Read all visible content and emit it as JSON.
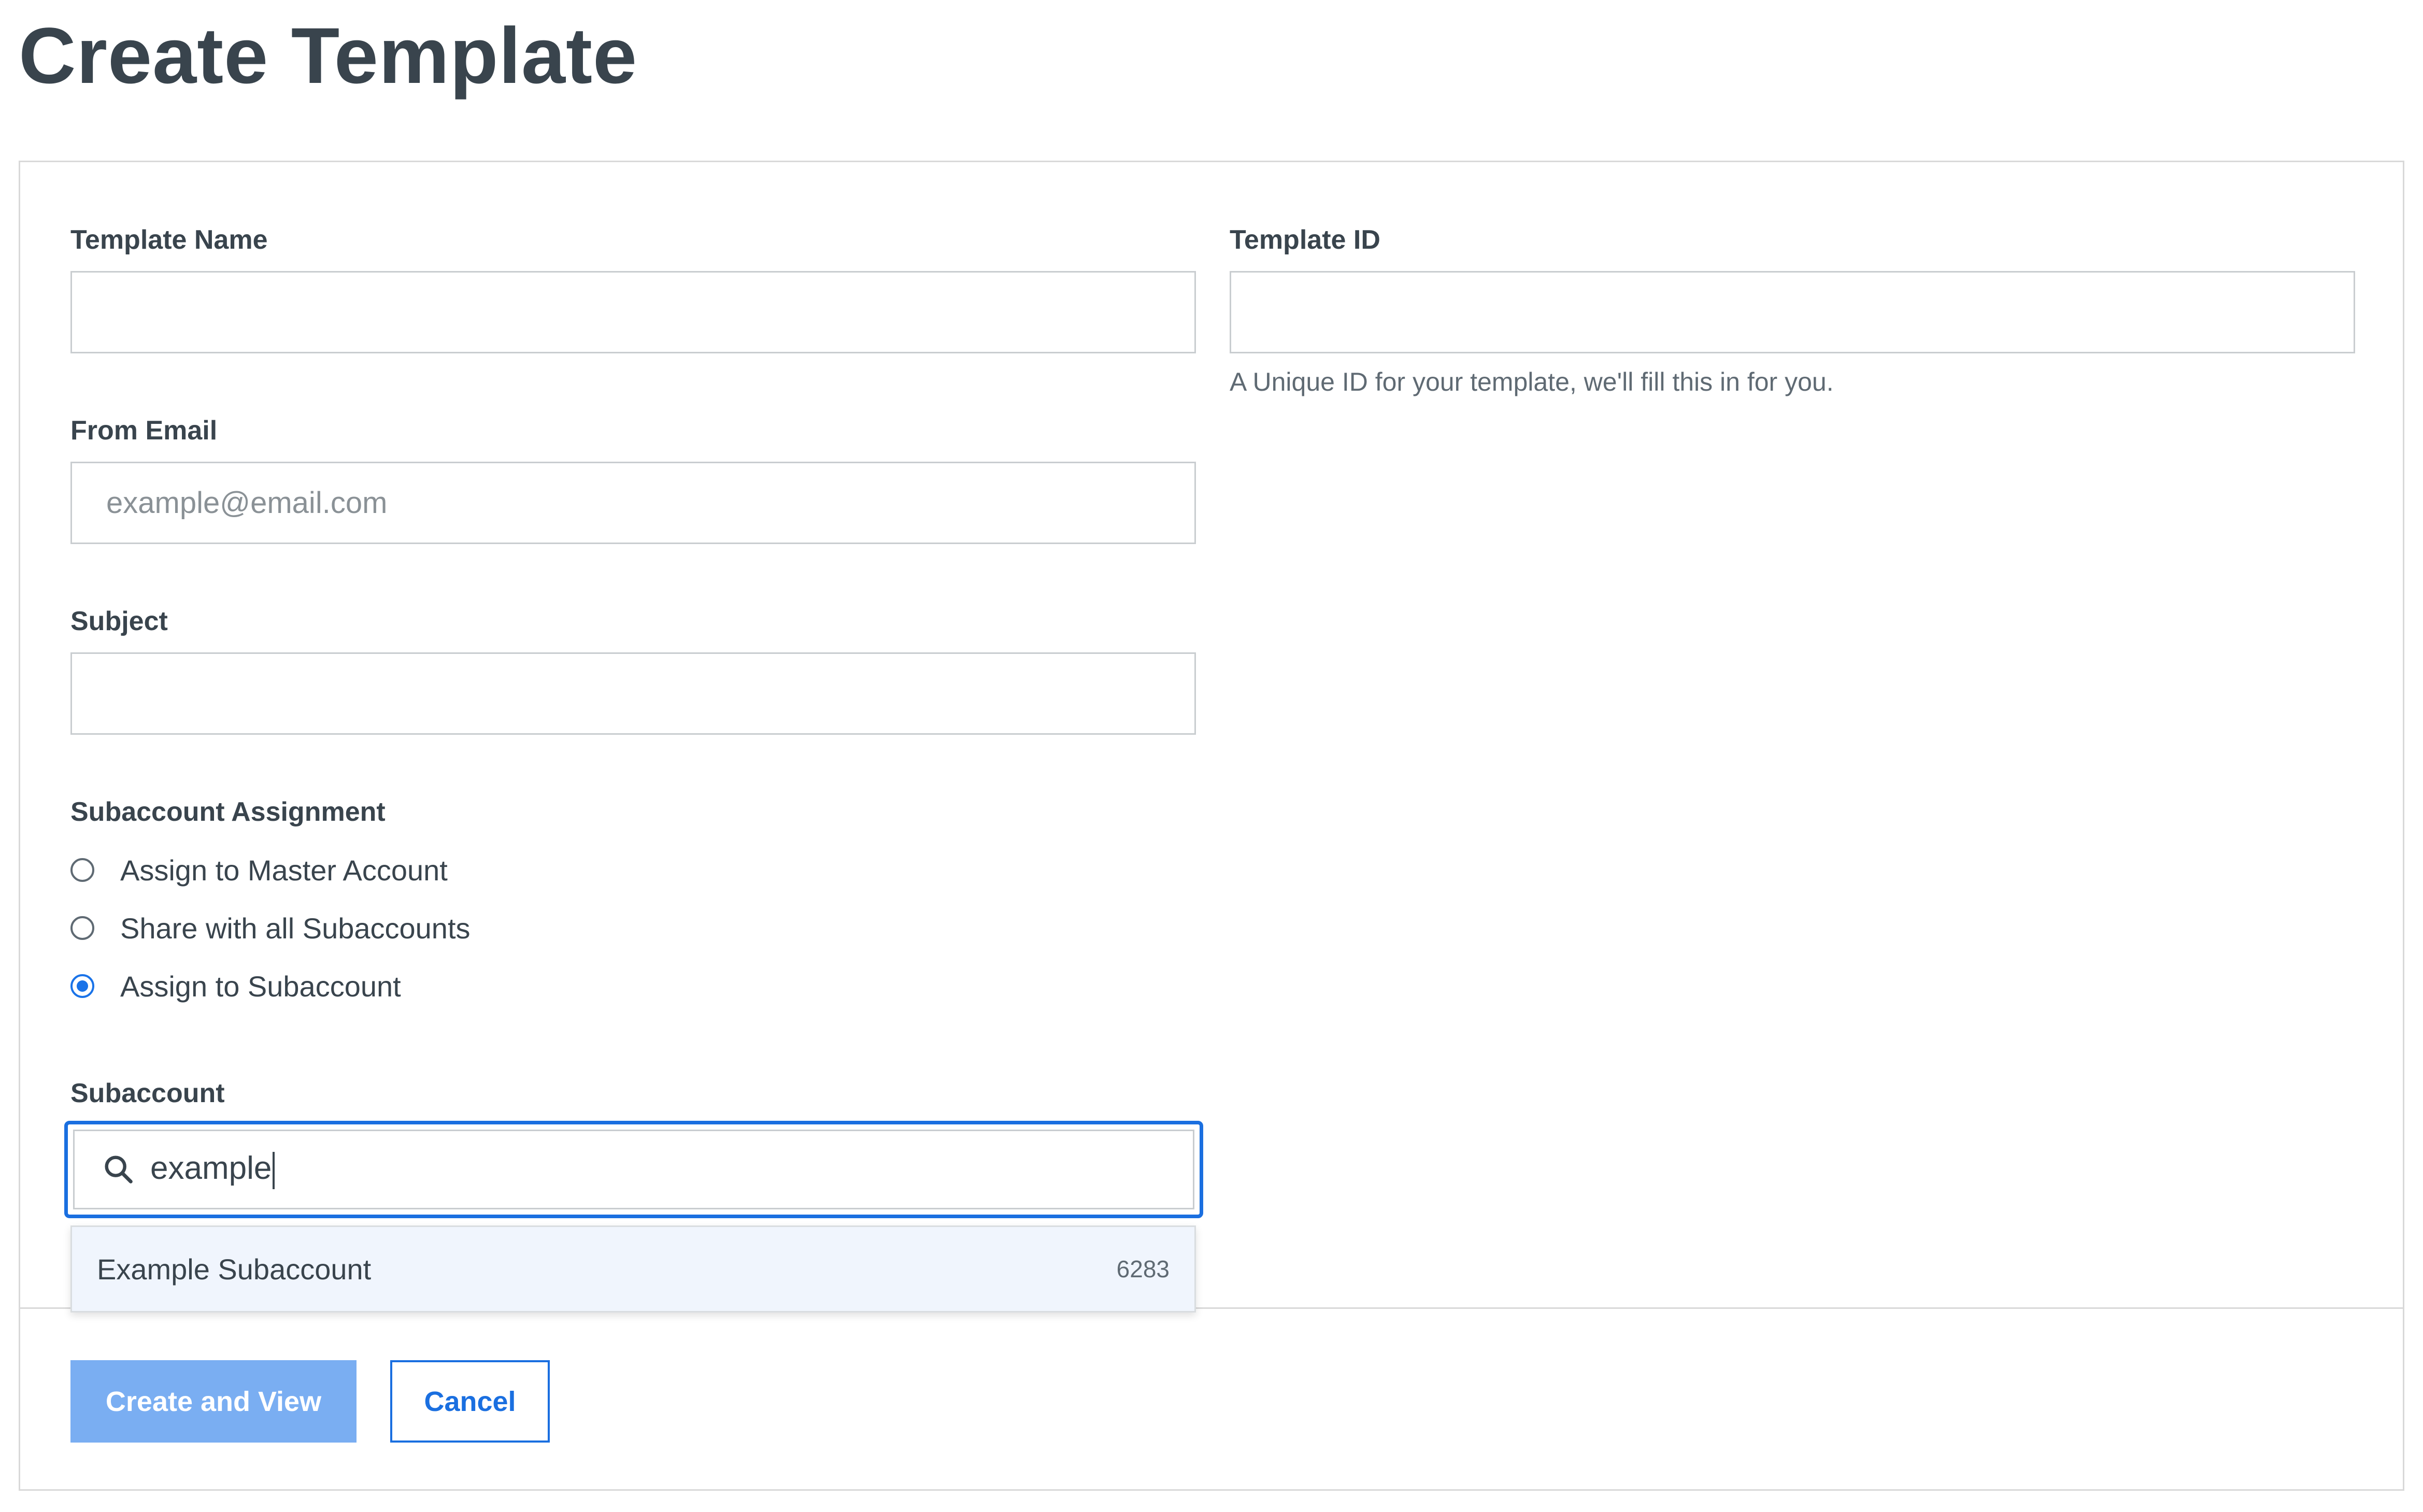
{
  "page": {
    "title": "Create Template"
  },
  "form": {
    "template_name": {
      "label": "Template Name",
      "value": "",
      "placeholder": ""
    },
    "template_id": {
      "label": "Template ID",
      "value": "",
      "placeholder": "",
      "help": "A Unique ID for your template, we'll fill this in for you."
    },
    "from_email": {
      "label": "From Email",
      "value": "",
      "placeholder": "example@email.com"
    },
    "subject": {
      "label": "Subject",
      "value": "",
      "placeholder": ""
    },
    "subaccount_assignment": {
      "label": "Subaccount Assignment",
      "options": [
        {
          "label": "Assign to Master Account",
          "selected": false
        },
        {
          "label": "Share with all Subaccounts",
          "selected": false
        },
        {
          "label": "Assign to Subaccount",
          "selected": true
        }
      ]
    },
    "subaccount": {
      "label": "Subaccount",
      "search_value": "example",
      "search_icon": "search-icon",
      "results": [
        {
          "name": "Example Subaccount",
          "id": "6283"
        }
      ]
    }
  },
  "actions": {
    "create_label": "Create and View",
    "cancel_label": "Cancel"
  },
  "colors": {
    "accent": "#1a6fe0",
    "primary_button_disabled": "#7aaef2",
    "dropdown_highlight": "#f0f5fd",
    "text": "#39444d"
  }
}
